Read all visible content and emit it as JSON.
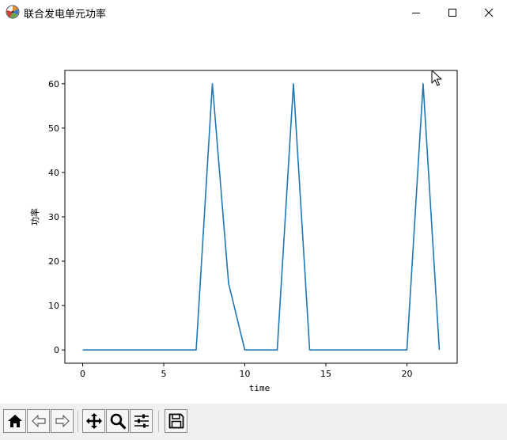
{
  "window": {
    "title": "联合发电单元功率",
    "icon": "matplotlib-logo-icon"
  },
  "chart_data": {
    "type": "line",
    "x": [
      0,
      1,
      2,
      3,
      4,
      5,
      6,
      7,
      8,
      9,
      10,
      11,
      12,
      13,
      14,
      15,
      16,
      17,
      18,
      19,
      20,
      21,
      22
    ],
    "series": [
      {
        "values": [
          0,
          0,
          0,
          0,
          0,
          0,
          0,
          0,
          60,
          15,
          0,
          0,
          0,
          60,
          0,
          0,
          0,
          0,
          0,
          0,
          0,
          60,
          0
        ],
        "color": "#1f77b4"
      }
    ],
    "xlabel": "time",
    "ylabel": "功率",
    "xlim": [
      -1.1,
      23.1
    ],
    "ylim": [
      -3,
      63
    ],
    "xticks": [
      0,
      5,
      10,
      15,
      20
    ],
    "yticks": [
      0,
      10,
      20,
      30,
      40,
      50,
      60
    ],
    "grid": false
  },
  "toolbar": {
    "buttons": [
      {
        "name": "home-button",
        "icon": "home-icon"
      },
      {
        "name": "back-button",
        "icon": "arrow-left-icon"
      },
      {
        "name": "forward-button",
        "icon": "arrow-right-icon"
      },
      {
        "name": "pan-button",
        "icon": "move-icon"
      },
      {
        "name": "zoom-button",
        "icon": "magnifier-icon"
      },
      {
        "name": "configure-subplots-button",
        "icon": "sliders-icon"
      },
      {
        "name": "save-button",
        "icon": "floppy-disk-icon"
      }
    ]
  }
}
